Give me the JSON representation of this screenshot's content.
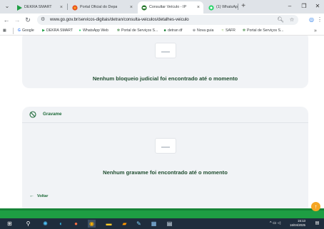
{
  "browser": {
    "tabs": [
      {
        "label": "DEKRA SMART",
        "icon": "dekra-triangle-icon",
        "active": false
      },
      {
        "label": "Portal Oficial do Depa",
        "icon": "detran-portal-icon",
        "active": false
      },
      {
        "label": "Consultar Veículo - IP",
        "icon": "veiculo-icon",
        "active": true
      },
      {
        "label": "(1) WhatsApp",
        "icon": "whatsapp-icon",
        "active": false
      }
    ],
    "new_tab_glyph": "+",
    "url": "www.go.gov.br/servicos-digitais/detran/consulta-veiculos/detalhes-veiculo",
    "bookmarks": [
      {
        "label": "Google",
        "icon": "google-icon"
      },
      {
        "label": "DEKRA SMART",
        "icon": "dekra-triangle-icon"
      },
      {
        "label": "WhatsApp Web",
        "icon": "whatsapp-icon"
      },
      {
        "label": "Portal de Serviços S...",
        "icon": "portal-servicos-icon"
      },
      {
        "label": "detran df",
        "icon": "detran-df-icon"
      },
      {
        "label": "Nova guia",
        "icon": "globe-icon"
      },
      {
        "label": "SAFR",
        "icon": "safr-icon"
      },
      {
        "label": "Portal de Serviços S...",
        "icon": "portal-servicos-icon"
      }
    ],
    "bookmarks_more": "»"
  },
  "page": {
    "bloqueio_empty_message": "Nenhum bloqueio judicial foi encontrado até o momento",
    "gravame_section_title": "Gravame",
    "gravame_empty_message": "Nenhum gravame foi encontrado até o momento",
    "back_label": "Voltar"
  },
  "taskbar": {
    "time": "15:13",
    "date": "16/04/2025"
  },
  "colors": {
    "brand_green": "#1f6b3a",
    "footer_green": "#1e9e43",
    "fab_orange": "#f5a623",
    "card_bg": "#f1f3f6"
  }
}
